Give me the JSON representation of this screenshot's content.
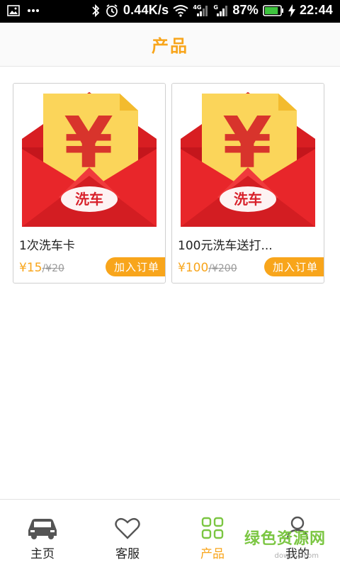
{
  "status_bar": {
    "speed": "0.44K/s",
    "network_4g": "4G",
    "network_g": "G",
    "battery_percent": "87%",
    "time": "22:44",
    "battery_level": 0.87
  },
  "header": {
    "title": "产品"
  },
  "products": [
    {
      "name": "1次洗车卡",
      "price": "¥15",
      "old_price": "/¥20",
      "add_label": "加入订单",
      "logo_text": "洗车"
    },
    {
      "name": "100元洗车送打...",
      "price": "¥100",
      "old_price": "/¥200",
      "add_label": "加入订单",
      "logo_text": "洗车"
    }
  ],
  "bottom_nav": {
    "items": [
      {
        "label": "主页",
        "icon": "car-icon",
        "active": false
      },
      {
        "label": "客服",
        "icon": "heart-icon",
        "active": false
      },
      {
        "label": "产品",
        "icon": "grid-icon",
        "active": true
      },
      {
        "label": "我的",
        "icon": "user-icon",
        "active": false
      }
    ]
  },
  "watermark": {
    "text": "绿色资源网",
    "sub": "downcc.com"
  },
  "colors": {
    "accent": "#f8a51b",
    "active_green": "#7bc642",
    "envelope_red": "#e8262a"
  }
}
